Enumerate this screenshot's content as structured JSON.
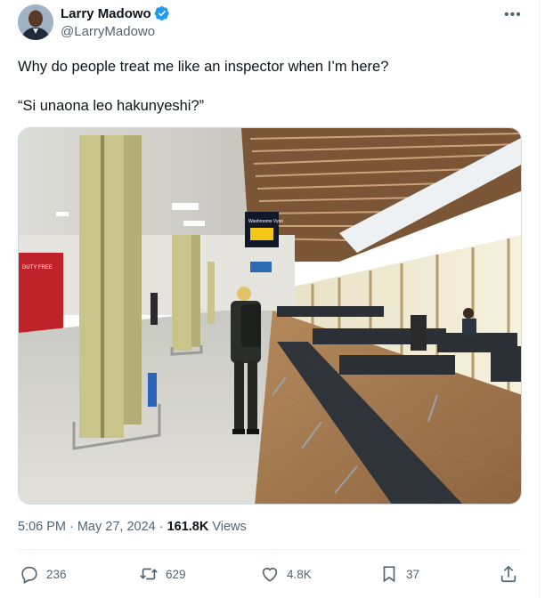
{
  "author": {
    "display_name": "Larry Madowo",
    "handle": "@LarryMadowo",
    "verified_color": "#1d9bf0"
  },
  "tweet": {
    "lines": [
      "Why do people treat me like an inspector when I’m here?",
      "“Si unaona leo hakunyeshi?”"
    ],
    "media": {
      "sign_text": "Washrooms Vyoo",
      "shop_text": "DUTY FREE"
    },
    "time": "5:06 PM",
    "date": "May 27, 2024",
    "separator": "·",
    "views_count": "161.8K",
    "views_label": "Views"
  },
  "actions": {
    "replies": "236",
    "reposts": "629",
    "likes": "4.8K",
    "bookmarks": "37"
  },
  "icons": {
    "more": "more-icon",
    "reply": "reply-icon",
    "repost": "repost-icon",
    "like": "heart-icon",
    "bookmark": "bookmark-icon",
    "share": "share-icon"
  }
}
